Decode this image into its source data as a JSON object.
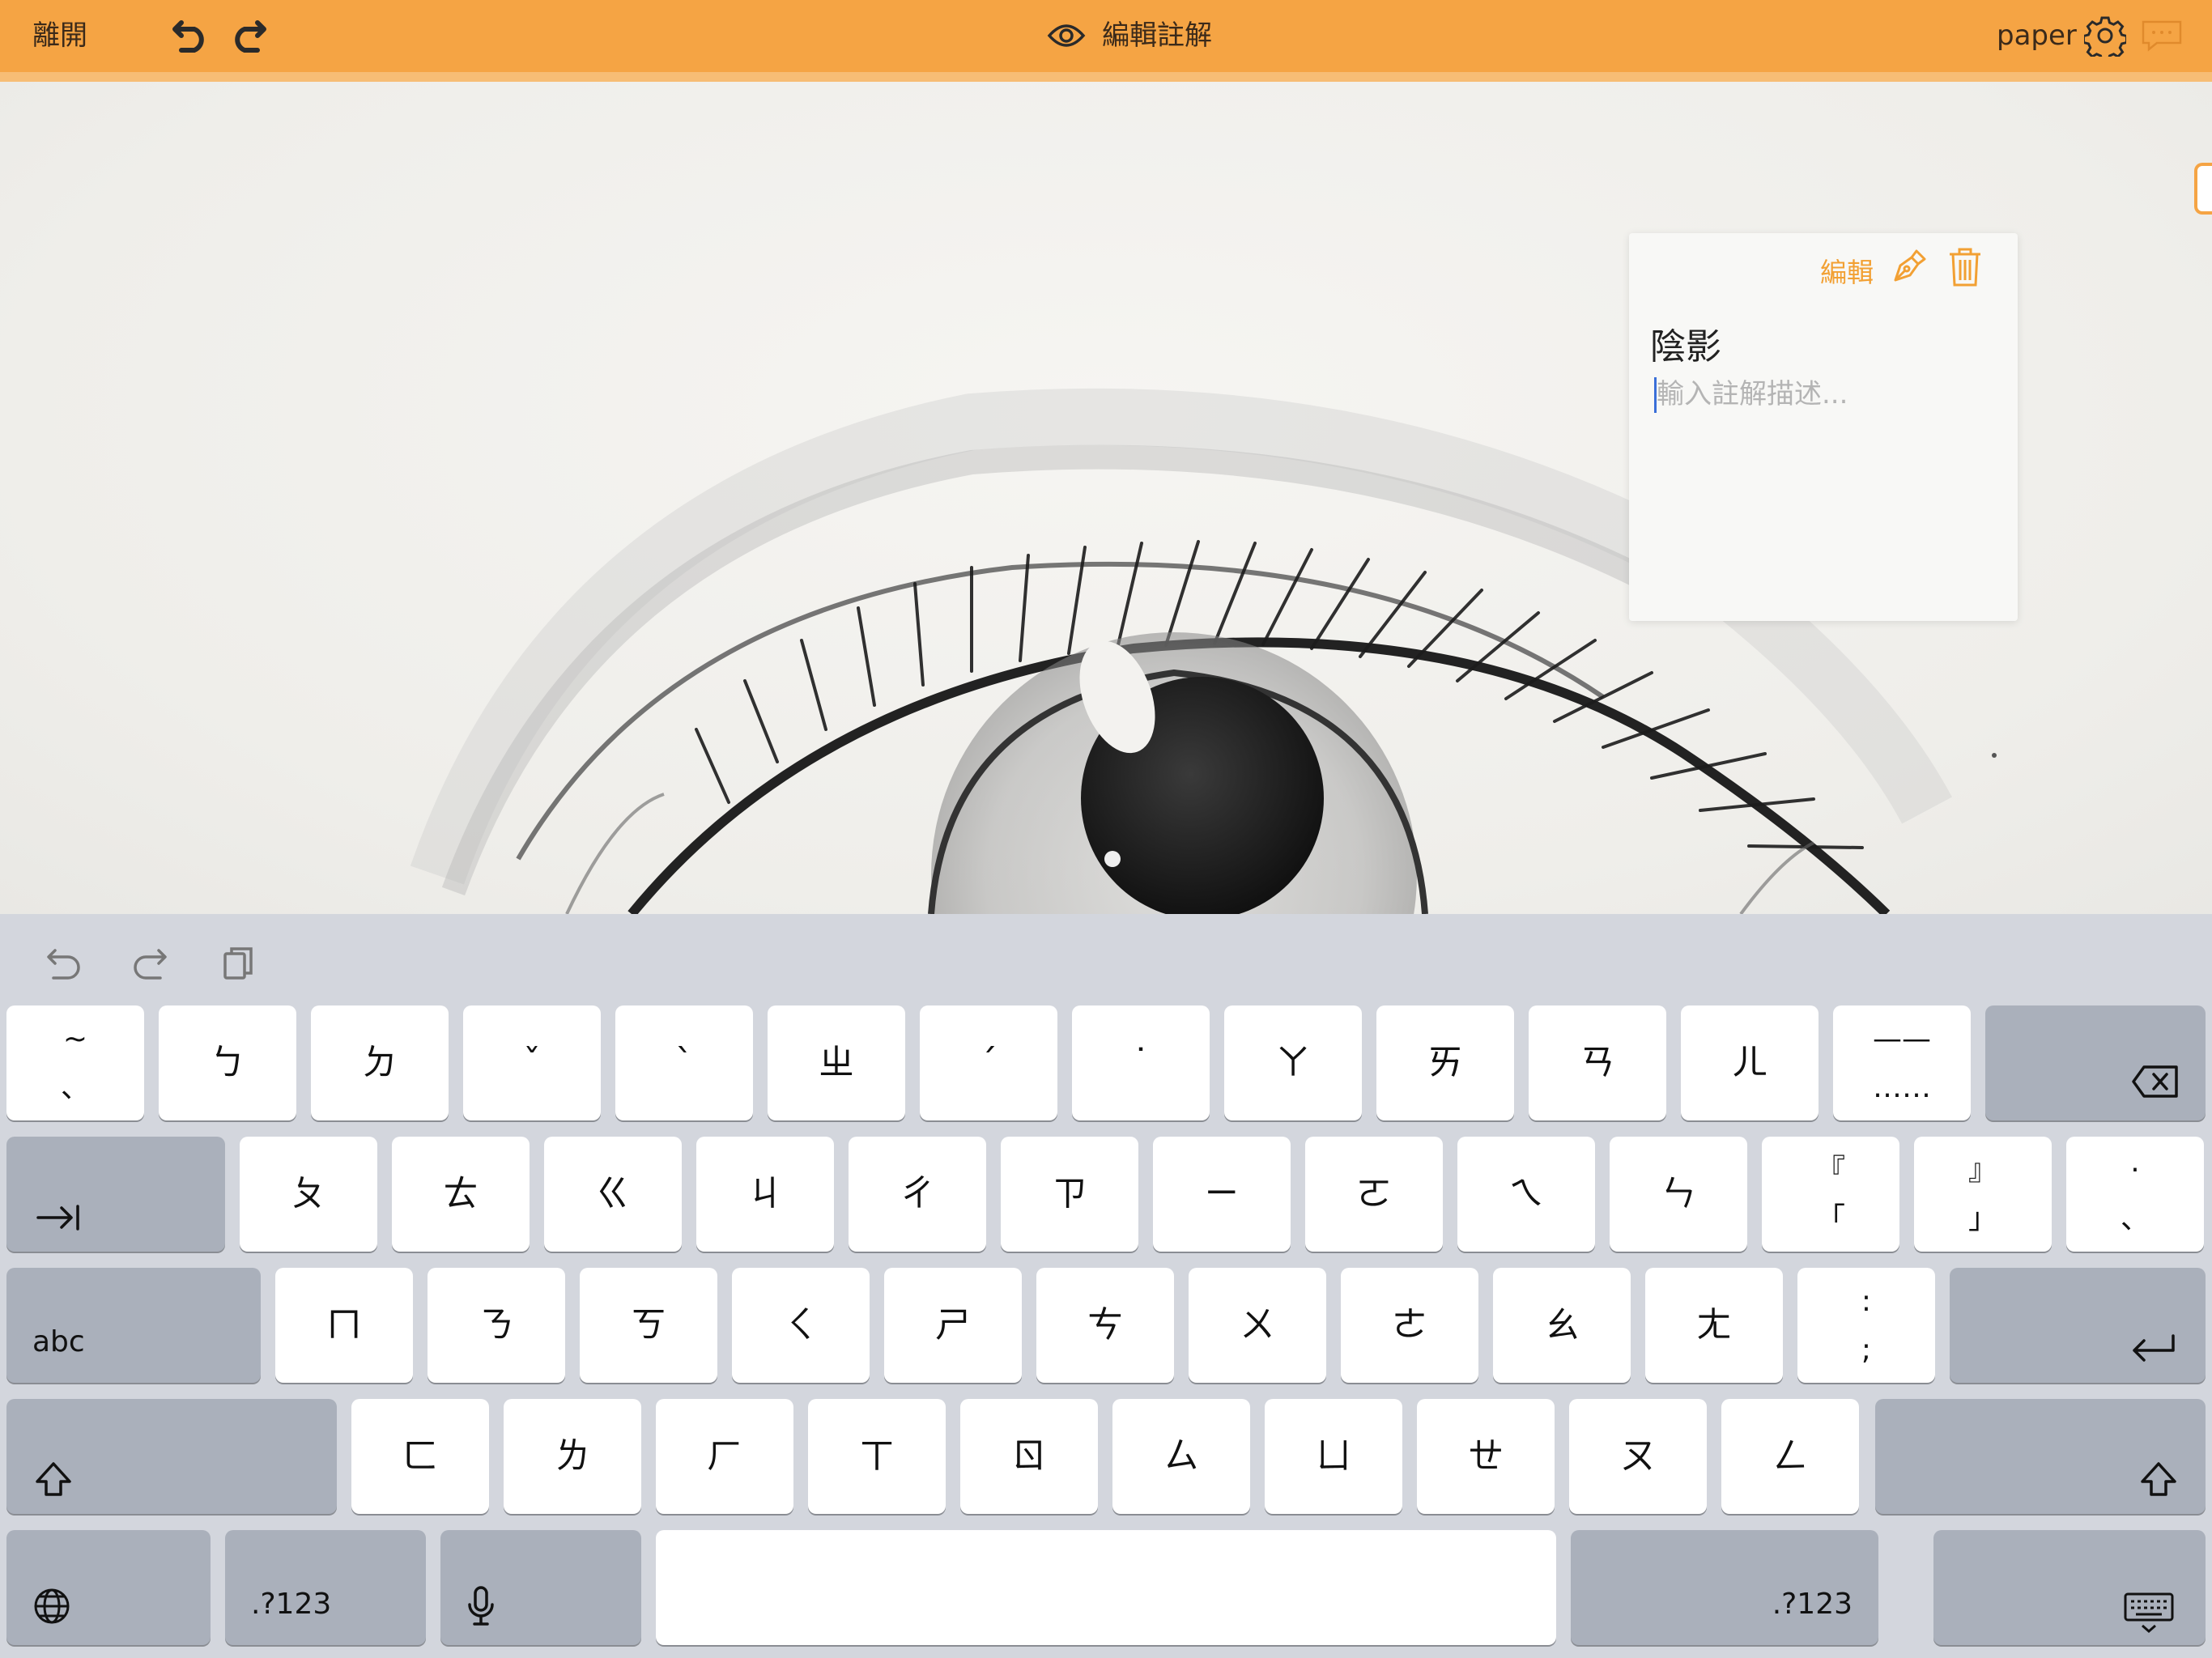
{
  "topbar": {
    "leave_label": "離開",
    "title": "編輯註解",
    "document_name": "paper",
    "icons": [
      "undo-icon",
      "redo-icon",
      "eye-icon",
      "gear-icon",
      "comment-icon"
    ]
  },
  "note": {
    "edit_label": "編輯",
    "title": "陰影",
    "description_placeholder": "輸入註解描述...",
    "description_value": ""
  },
  "keyboard_shortcuts": [
    "undo-icon",
    "redo-icon",
    "paste-icon"
  ],
  "keyboard": {
    "row1": [
      {
        "top": "~",
        "bottom": "、"
      },
      {
        "main": "ㄅ"
      },
      {
        "main": "ㄉ"
      },
      {
        "main": "ˇ"
      },
      {
        "main": "ˋ"
      },
      {
        "main": "ㄓ"
      },
      {
        "main": "ˊ"
      },
      {
        "main": "˙"
      },
      {
        "main": "ㄚ"
      },
      {
        "main": "ㄞ"
      },
      {
        "main": "ㄢ"
      },
      {
        "main": "ㄦ"
      },
      {
        "top": "——",
        "bottom": "……"
      }
    ],
    "row2": [
      {
        "main": "ㄆ"
      },
      {
        "main": "ㄊ"
      },
      {
        "main": "ㄍ"
      },
      {
        "main": "ㄐ"
      },
      {
        "main": "ㄔ"
      },
      {
        "main": "ㄗ"
      },
      {
        "main": "ㄧ"
      },
      {
        "main": "ㄛ"
      },
      {
        "main": "ㄟ"
      },
      {
        "main": "ㄣ"
      },
      {
        "top": "『",
        "bottom": "「"
      },
      {
        "top": "』",
        "bottom": "」"
      },
      {
        "top": "·",
        "bottom": "、"
      }
    ],
    "row3": [
      {
        "main": "ㄇ"
      },
      {
        "main": "ㄋ"
      },
      {
        "main": "ㄎ"
      },
      {
        "main": "ㄑ"
      },
      {
        "main": "ㄕ"
      },
      {
        "main": "ㄘ"
      },
      {
        "main": "ㄨ"
      },
      {
        "main": "ㄜ"
      },
      {
        "main": "ㄠ"
      },
      {
        "main": "ㄤ"
      },
      {
        "top": ":",
        "bottom": ";"
      }
    ],
    "row4": [
      {
        "main": "ㄈ"
      },
      {
        "main": "ㄌ"
      },
      {
        "main": "ㄏ"
      },
      {
        "main": "ㄒ"
      },
      {
        "main": "ㄖ"
      },
      {
        "main": "ㄙ"
      },
      {
        "main": "ㄩ"
      },
      {
        "main": "ㄝ"
      },
      {
        "main": "ㄡ"
      },
      {
        "main": "ㄥ"
      }
    ],
    "abc_label": "abc",
    "numbers_label": ".?123",
    "special_icons": [
      "backspace-icon",
      "tab-icon",
      "return-icon",
      "shift-icon",
      "globe-icon",
      "microphone-icon",
      "keyboard-dismiss-icon"
    ]
  }
}
